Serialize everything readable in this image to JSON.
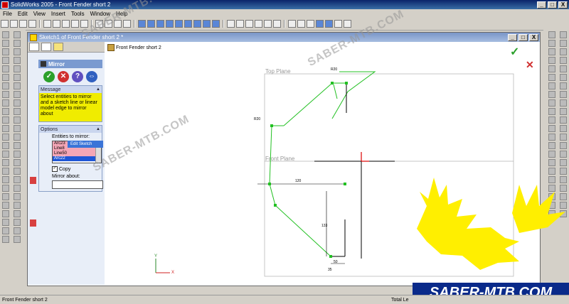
{
  "window": {
    "title": "SolidWorks 2005 - Front Fender short 2",
    "minimize": "_",
    "maximize": "□",
    "close": "X"
  },
  "menu": [
    "File",
    "Edit",
    "View",
    "Insert",
    "Tools",
    "Window",
    "Help"
  ],
  "document": {
    "title": "Sketch1 of Front Fender short 2 *"
  },
  "property_manager": {
    "title": "Mirror",
    "ok": "✓",
    "cancel": "✕",
    "help": "?",
    "detail": "⇔",
    "message_header": "Message",
    "message": "Select entities to mirror and a sketch line or linear model edge to mirror about",
    "options_header": "Options",
    "entities_label": "Entities to mirror:",
    "entities": [
      "Arc23",
      "Line8",
      "Line50",
      "Arc22"
    ],
    "copy_label": "Copy",
    "mirror_about_label": "Mirror about:",
    "mirror_about_value": ""
  },
  "tooltip": "Edit Sketch",
  "tree_root": "Front Fender short 2",
  "plane_labels": {
    "top": "Top Plane",
    "front": "Front Plane"
  },
  "dimensions": {
    "d1": "R20",
    "d2": "R20",
    "d3": "120",
    "d4": "133",
    "d5": "50",
    "d6": "35"
  },
  "triad": {
    "x": "X",
    "y": "Y"
  },
  "status": {
    "left": "Front Fender short 2",
    "right": "Total Le"
  },
  "watermarks": [
    "SABER-MTB.COM",
    "SABER-MTB.COM",
    "SABER-MTB.COM"
  ],
  "brand_text": "SABER-MTB.COM",
  "colors": {
    "sketch_line": "#22c022",
    "dimension": "#000000",
    "brand_yellow": "#ffef00",
    "brand_navy": "#0a2a8a"
  }
}
